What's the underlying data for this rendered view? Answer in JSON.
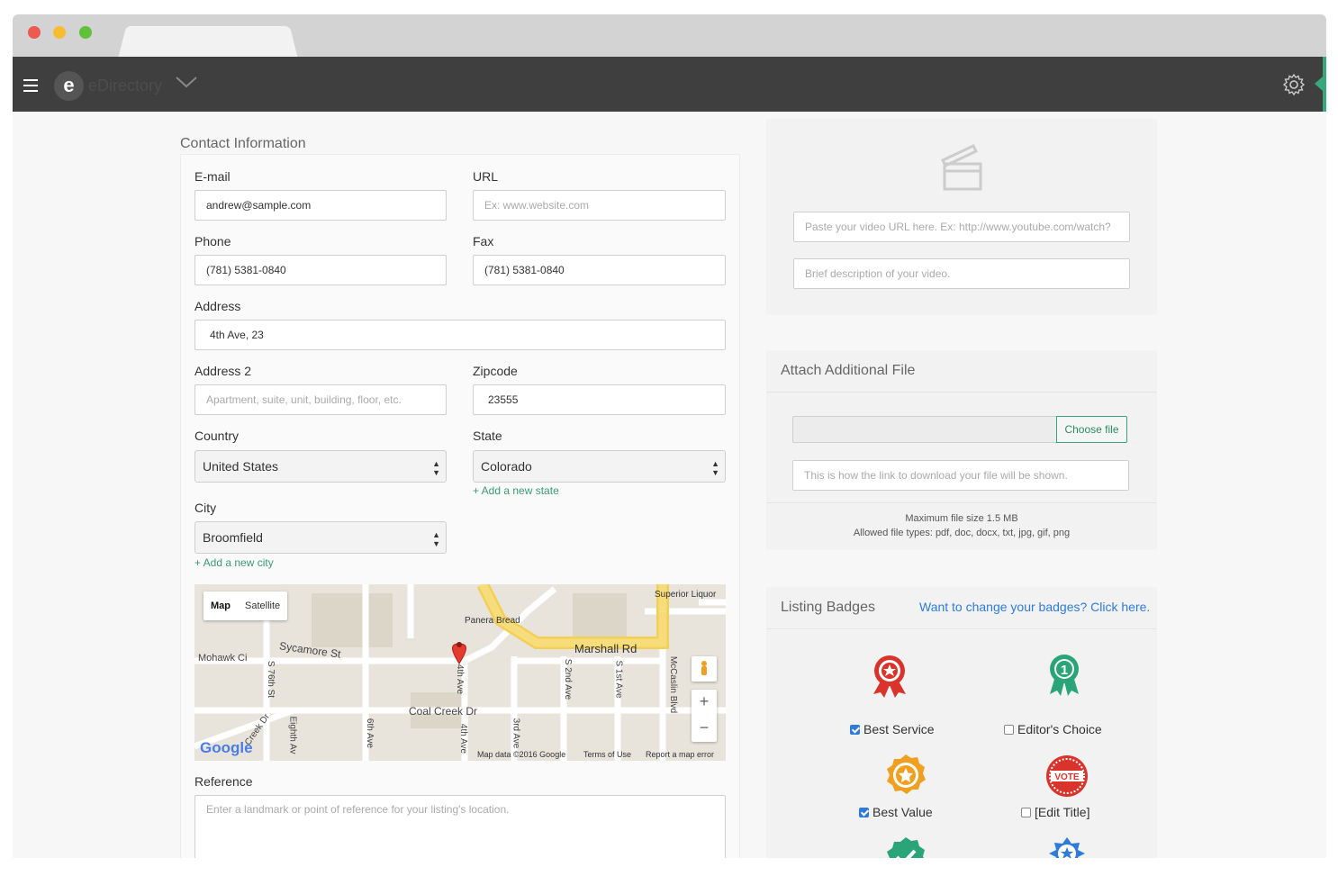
{
  "app": {
    "brand": "eDirectory",
    "logo_letter": "e"
  },
  "contact": {
    "section_title": "Contact Information",
    "email": {
      "label": "E-mail",
      "value": "andrew@sample.com"
    },
    "url": {
      "label": "URL",
      "placeholder": "Ex: www.website.com"
    },
    "phone": {
      "label": "Phone",
      "value": "(781) 5381-0840"
    },
    "fax": {
      "label": "Fax",
      "value": "(781) 5381-0840"
    },
    "address": {
      "label": "Address",
      "value": "4th Ave, 23"
    },
    "address2": {
      "label": "Address 2",
      "placeholder": "Apartment, suite, unit, building, floor, etc."
    },
    "zipcode": {
      "label": "Zipcode",
      "value": "23555"
    },
    "country": {
      "label": "Country",
      "value": "United States"
    },
    "state": {
      "label": "State",
      "value": "Colorado",
      "add_link": "+ Add a new state"
    },
    "city": {
      "label": "City",
      "value": "Broomfield",
      "add_link": "+ Add a new city"
    },
    "reference": {
      "label": "Reference",
      "placeholder": "Enter a landmark or point of reference for your listing's location."
    }
  },
  "map": {
    "btn_map": "Map",
    "btn_satellite": "Satellite",
    "streets": [
      "Sycamore St",
      "Marshall Rd",
      "Coal Creek Dr",
      "Mohawk Ci",
      "S 76th St",
      "4th Ave",
      "S 2nd Ave",
      "S 1st Ave",
      "McCaslin Blvd",
      "Eighth Av",
      "6th Ave",
      "3rd Ave",
      "Creek Dr",
      "4th Ave"
    ],
    "places": [
      "Panera Bread",
      "Superior Liquor"
    ],
    "google": "Google",
    "footer_data": "Map data ©2016 Google",
    "footer_terms": "Terms of Use",
    "footer_report": "Report a map error",
    "zoom_in": "+",
    "zoom_out": "−"
  },
  "video": {
    "url_placeholder": "Paste your video URL here. Ex: http://www.youtube.com/watch?",
    "desc_placeholder": "Brief description of your video."
  },
  "attach": {
    "title": "Attach Additional File",
    "choose_btn": "Choose file",
    "link_placeholder": "This is how the link to download your file will be shown.",
    "max_size": "Maximum file size 1.5 MB",
    "allowed": "Allowed file types: pdf, doc, docx, txt, jpg, gif, png"
  },
  "badges": {
    "title": "Listing Badges",
    "change_link": "Want to change your badges? Click here.",
    "items": [
      {
        "label": "Best Service",
        "checked": true,
        "icon": "ribbon-star-icon",
        "color": "#d9342b"
      },
      {
        "label": "Editor's Choice",
        "checked": false,
        "icon": "ribbon-one-icon",
        "color": "#2aa57a"
      },
      {
        "label": "Best Value",
        "checked": true,
        "icon": "gear-star-icon",
        "color": "#f0a020"
      },
      {
        "label": "[Edit Title]",
        "checked": false,
        "icon": "vote-badge-icon",
        "color": "#d9342b"
      },
      {
        "label": "",
        "checked": false,
        "icon": "check-badge-icon",
        "color": "#2aa57a"
      },
      {
        "label": "",
        "checked": false,
        "icon": "star-badge-icon",
        "color": "#2f7bd9"
      }
    ]
  },
  "colors": {
    "topbar": "#3f3f3f",
    "accent": "#3aa67c",
    "link": "#2f7bd9"
  }
}
